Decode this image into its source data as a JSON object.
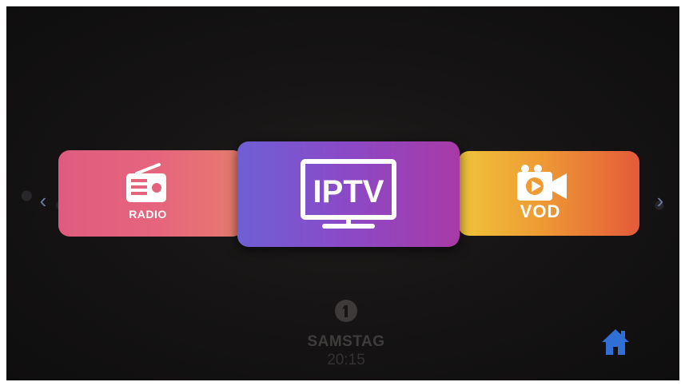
{
  "menu": {
    "left_arrow": "‹",
    "right_arrow": "›",
    "tiles": [
      {
        "id": "radio",
        "label": "RADIO",
        "icon": "radio-icon"
      },
      {
        "id": "iptv",
        "label": "IPTV",
        "icon": "tv-icon"
      },
      {
        "id": "vod",
        "label": "VOD",
        "icon": "video-camera-icon"
      }
    ]
  },
  "channel": {
    "logo": "das-erste-logo",
    "day": "SAMSTAG",
    "time": "20:15"
  },
  "home": {
    "icon": "home-icon",
    "color": "#2f6fd6"
  },
  "colors": {
    "radio_tile": "#e3637d",
    "iptv_tile": "#8b49c6",
    "vod_tile": "#ee9b34",
    "background": "#161414"
  }
}
